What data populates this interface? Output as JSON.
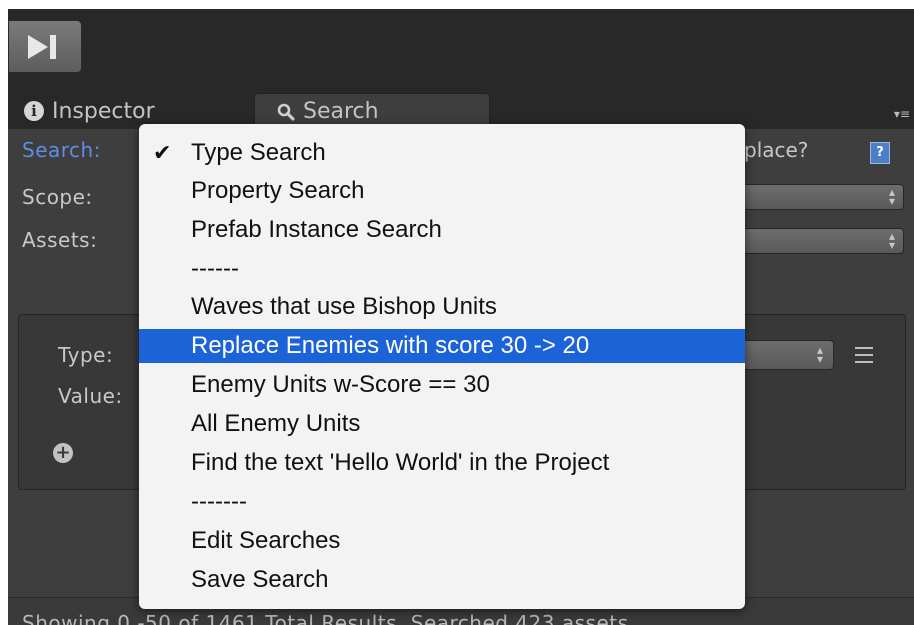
{
  "inspector_tab": {
    "label": "Inspector"
  },
  "search_tab": {
    "label": "Search"
  },
  "form": {
    "search_label": "Search:",
    "scope_label": "Scope:",
    "assets_label": "Assets:",
    "replace_partial": "place?",
    "help_icon_text": "?"
  },
  "criteria": {
    "type_label": "Type:",
    "value_label": "Value:"
  },
  "status": {
    "text": "Showing 0 -50 of 1461 Total Results. Searched 423 assets."
  },
  "menu": {
    "items": [
      {
        "label": "Type Search",
        "checked": true
      },
      {
        "label": "Property Search"
      },
      {
        "label": "Prefab Instance Search"
      },
      {
        "label": "------",
        "separator": true
      },
      {
        "label": "Waves that use Bishop Units"
      },
      {
        "label": "Replace Enemies with score 30 -> 20",
        "highlighted": true
      },
      {
        "label": "Enemy Units w-Score == 30"
      },
      {
        "label": "All Enemy Units"
      },
      {
        "label": "Find the text 'Hello World' in the Project"
      },
      {
        "label": "-------",
        "separator": true
      },
      {
        "label": "Edit Searches"
      },
      {
        "label": "Save Search"
      }
    ]
  },
  "colors": {
    "highlight": "#1d63d8",
    "search_label": "#5e8ee4",
    "panel_bg": "#3e3e3e",
    "toolbar_bg": "#282828",
    "menu_bg": "#f3f3f3"
  },
  "icons": {
    "step": "step-forward-icon",
    "info": "info-icon",
    "search": "magnifier-icon",
    "help": "help-icon",
    "add": "add-icon",
    "menu": "hamburger-icon",
    "check": "checkmark-icon"
  }
}
